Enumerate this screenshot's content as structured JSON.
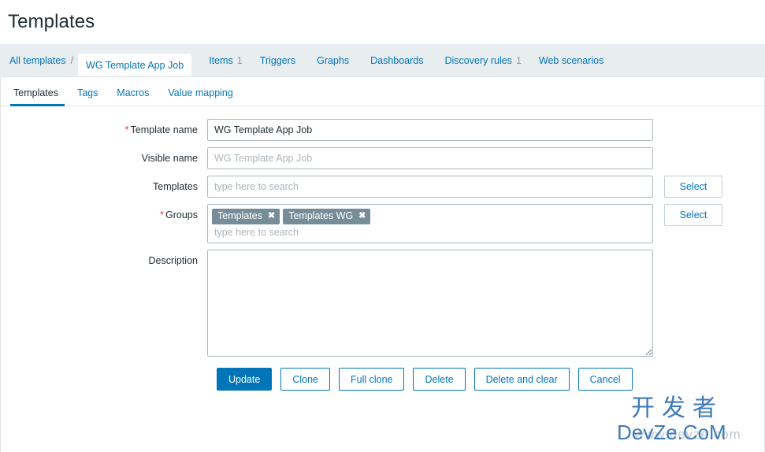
{
  "header": {
    "title": "Templates"
  },
  "breadcrumb": {
    "all_templates": "All templates",
    "separator": "/",
    "current": "WG Template App Job",
    "tabs": [
      {
        "label": "Items",
        "count": "1"
      },
      {
        "label": "Triggers",
        "count": ""
      },
      {
        "label": "Graphs",
        "count": ""
      },
      {
        "label": "Dashboards",
        "count": ""
      },
      {
        "label": "Discovery rules",
        "count": "1"
      },
      {
        "label": "Web scenarios",
        "count": ""
      }
    ]
  },
  "form_tabs": [
    {
      "label": "Templates",
      "active": true
    },
    {
      "label": "Tags",
      "active": false
    },
    {
      "label": "Macros",
      "active": false
    },
    {
      "label": "Value mapping",
      "active": false
    }
  ],
  "form": {
    "template_name": {
      "label": "Template name",
      "required": true,
      "value": "WG Template App Job"
    },
    "visible_name": {
      "label": "Visible name",
      "required": false,
      "value": "",
      "placeholder": "WG Template App Job"
    },
    "templates": {
      "label": "Templates",
      "required": false,
      "value": "",
      "placeholder": "type here to search",
      "select_label": "Select"
    },
    "groups": {
      "label": "Groups",
      "required": true,
      "chips": [
        {
          "label": "Templates",
          "remove_icon": "close-icon"
        },
        {
          "label": "Templates WG",
          "remove_icon": "close-icon"
        }
      ],
      "placeholder": "type here to search",
      "select_label": "Select"
    },
    "description": {
      "label": "Description",
      "value": "",
      "placeholder": ""
    }
  },
  "buttons": {
    "update": "Update",
    "clone": "Clone",
    "full_clone": "Full clone",
    "delete": "Delete",
    "delete_and_clear": "Delete and clear",
    "cancel": "Cancel"
  },
  "watermark": {
    "chinese": "开发者",
    "latin": "DevZe.CoM",
    "ghost": "www.devze.com"
  },
  "colors": {
    "accent": "#0275b8",
    "required": "#e33734",
    "chip_bg": "#768d99",
    "breadcrumb_bg": "#e8edf0"
  }
}
